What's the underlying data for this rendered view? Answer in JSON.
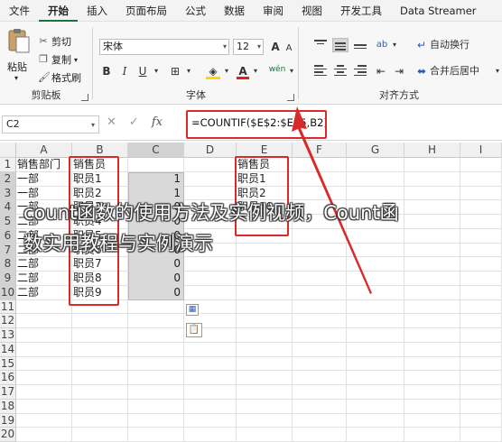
{
  "menu": {
    "items": [
      "文件",
      "开始",
      "插入",
      "页面布局",
      "公式",
      "数据",
      "审阅",
      "视图",
      "开发工具",
      "Data Streamer"
    ],
    "active": "开始"
  },
  "ribbon": {
    "clipboard": {
      "paste_label": "粘贴",
      "cut": "剪切",
      "copy": "复制",
      "format_painter": "格式刷",
      "group_label": "剪贴板"
    },
    "font": {
      "font_name": "宋体",
      "font_size": "12",
      "bold": "B",
      "italic": "I",
      "underline": "U",
      "grow": "A",
      "shrink": "A",
      "wen": "wén",
      "group_label": "字体"
    },
    "alignment": {
      "wrap_text": "自动换行",
      "merge_center": "合并后居中",
      "group_label": "对齐方式",
      "orient": "ab"
    }
  },
  "formula_bar": {
    "name_box": "C2",
    "cancel_icon": "✕",
    "enter_icon": "✓",
    "fx_label": "fx",
    "formula": "=COUNTIF($E$2:$E$5,B2)"
  },
  "grid": {
    "columns": [
      "A",
      "B",
      "C",
      "D",
      "E",
      "F",
      "G",
      "H",
      "I"
    ],
    "selected_column": "C",
    "rows": [
      "1",
      "2",
      "3",
      "4",
      "5",
      "6",
      "7",
      "8",
      "9",
      "10",
      "11",
      "12",
      "13",
      "14",
      "15",
      "16",
      "17",
      "18",
      "19",
      "20"
    ],
    "a_values": [
      "销售部门",
      "一部",
      "一部",
      "一部",
      "二部",
      "二部",
      "二部",
      "二部",
      "二部",
      "二部"
    ],
    "b_values": [
      "销售员",
      "职员1",
      "职员2",
      "职员3",
      "职员4",
      "职员5",
      "职员6",
      "职员7",
      "职员8",
      "职员9"
    ],
    "c_values": [
      "",
      "1",
      "1",
      "0",
      "0",
      "0",
      "0",
      "0",
      "0",
      "0"
    ],
    "e_values": [
      "销售员",
      "职员1",
      "职员2",
      "职员10"
    ]
  },
  "overlay": {
    "line1": "count函数的使用方法及实例视频，Count函",
    "line2": "数实用教程与实例演示"
  },
  "colors": {
    "accent": "#1e7145",
    "annotation_red": "#d92a2a",
    "selection_fill": "#d9d9d9"
  }
}
